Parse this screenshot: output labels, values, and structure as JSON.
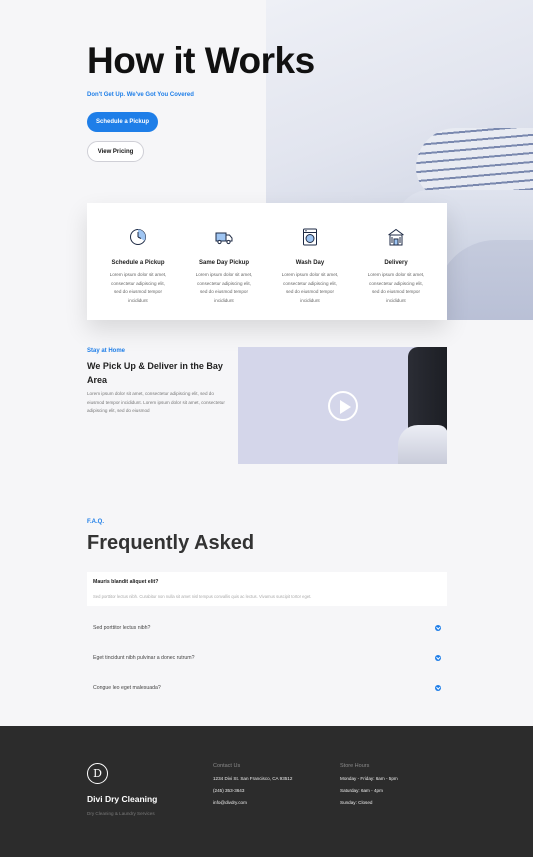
{
  "hero": {
    "title": "How it Works",
    "tagline": "Don't Get Up. We've Got You Covered",
    "primary_button": "Schedule a Pickup",
    "secondary_button": "View Pricing"
  },
  "steps": [
    {
      "icon": "schedule-clock-icon",
      "title": "Schedule a Pickup",
      "desc": "Lorem ipsum dolor sit amet, consectetur adipiscing elit, sed do eiusmod tempor incididunt"
    },
    {
      "icon": "delivery-truck-icon",
      "title": "Same Day Pickup",
      "desc": "Lorem ipsum dolor sit amet, consectetur adipiscing elit, sed do eiusmod tempor incididunt"
    },
    {
      "icon": "washing-machine-icon",
      "title": "Wash Day",
      "desc": "Lorem ipsum dolor sit amet, consectetur adipiscing elit, sed do eiusmod tempor incididunt"
    },
    {
      "icon": "store-building-icon",
      "title": "Delivery",
      "desc": "Lorem ipsum dolor sit amet, consectetur adipiscing elit, sed do eiusmod tempor incididunt"
    }
  ],
  "stay": {
    "kicker": "Stay at Home",
    "title": "We Pick Up & Deliver in the Bay Area",
    "text": "Lorem ipsum dolor sit amet, consectetur adipiscing elit, sed do eiusmod tempor incididunt. Lorem ipsum dolor sit amet, consectetur adipiscing elit, sed do eiusmod"
  },
  "faq": {
    "kicker": "F.A.Q.",
    "title": "Frequently Asked",
    "open": {
      "question": "Mauris blandit aliquet elit?",
      "answer": "Sed porttitor lectus nibh. Curabitur non nulla sit amet nisl tempus convallis quis ac lectus. Vivamus suscipit tortor eget."
    },
    "items": [
      "Sed porttitor lectus nibh?",
      "Eget tincidunt nibh pulvinar a donec rutrum?",
      "Congue leo eget malesuada?"
    ]
  },
  "footer": {
    "logo_letter": "D",
    "brand": "Divi Dry Cleaning",
    "brand_sub": "Dry Cleaning & Laundry Services",
    "contact_heading": "Contact Us",
    "contact_lines": [
      "1234 Divi St. San Francisco, CA 93512",
      "(245) 353-3643",
      "info@divdry.com"
    ],
    "hours_heading": "Store Hours",
    "hours_lines": [
      "Monday - Friday: 6am - 5pm",
      "Saturday: 6am - 4pm",
      "Sunday: Closed"
    ]
  },
  "colors": {
    "accent": "#1e7ee8",
    "footer_bg": "#2c2c2c",
    "page_bg": "#f6f6f8"
  }
}
